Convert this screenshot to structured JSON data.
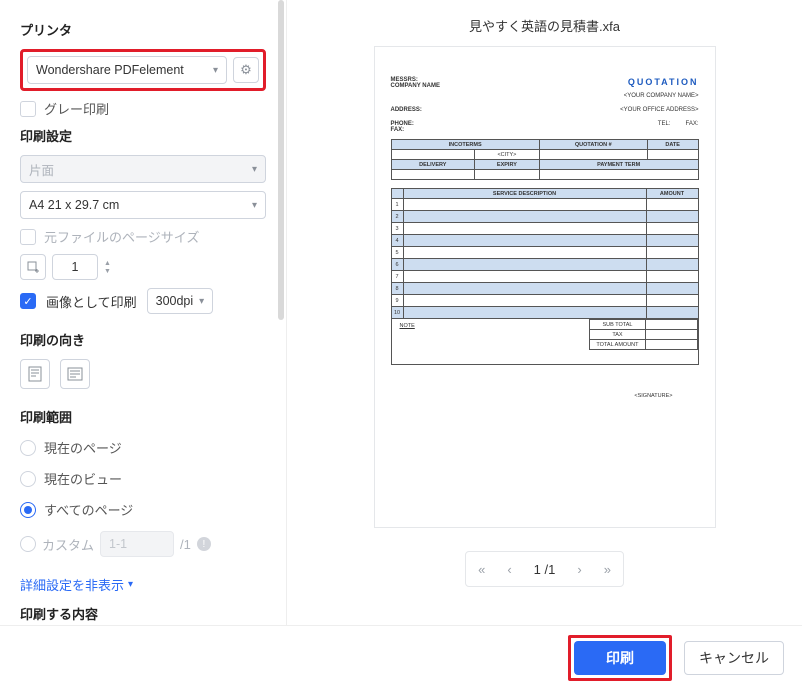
{
  "file_title": "見やすく英語の見積書.xfa",
  "sidebar": {
    "printer_section": "プリンタ",
    "printer_selected": "Wondershare PDFelement",
    "gray_print": "グレー印刷",
    "print_settings": "印刷設定",
    "duplex": "片面",
    "paper_size": "A4 21 x 29.7 cm",
    "use_source_size": "元ファイルのページサイズ",
    "copies": "1",
    "print_as_image": "画像として印刷",
    "dpi": "300dpi",
    "orientation": "印刷の向き",
    "range": "印刷範囲",
    "range_current_page": "現在のページ",
    "range_current_view": "現在のビュー",
    "range_all_pages": "すべてのページ",
    "range_custom": "カスタム",
    "custom_range": "1-1",
    "custom_total_prefix": "/1",
    "advanced": "詳細設定を非表示",
    "overflow": "印刷する内容"
  },
  "pager": {
    "page_text": "1 /1"
  },
  "footer": {
    "print": "印刷",
    "cancel": "キャンセル"
  },
  "doc": {
    "messrs": "MESSRS:",
    "company": "COMPANY NAME",
    "quotation_title": "QUOTATION",
    "your_company": "<YOUR COMPANY NAME>",
    "address_label": "ADDRESS:",
    "your_office": "<YOUR OFFICE ADDRESS>",
    "phone": "PHONE:",
    "fax": "FAX:",
    "tel": "TEL:",
    "fax2": "FAX:",
    "headers1": [
      "INCOTERMS",
      "QUOTATION #",
      "DATE"
    ],
    "city": "<CITY>",
    "headers2": [
      "DELIVERY",
      "EXPIRY",
      "PAYMENT TERM"
    ],
    "service_desc": "SERVICE DESCRIPTION",
    "amount": "AMOUNT",
    "note": "NOTE",
    "subtotal": "SUB  TOTAL",
    "tax": "TAX",
    "total": "TOTAL AMOUNT",
    "signature": "<SIGNATURE>"
  }
}
